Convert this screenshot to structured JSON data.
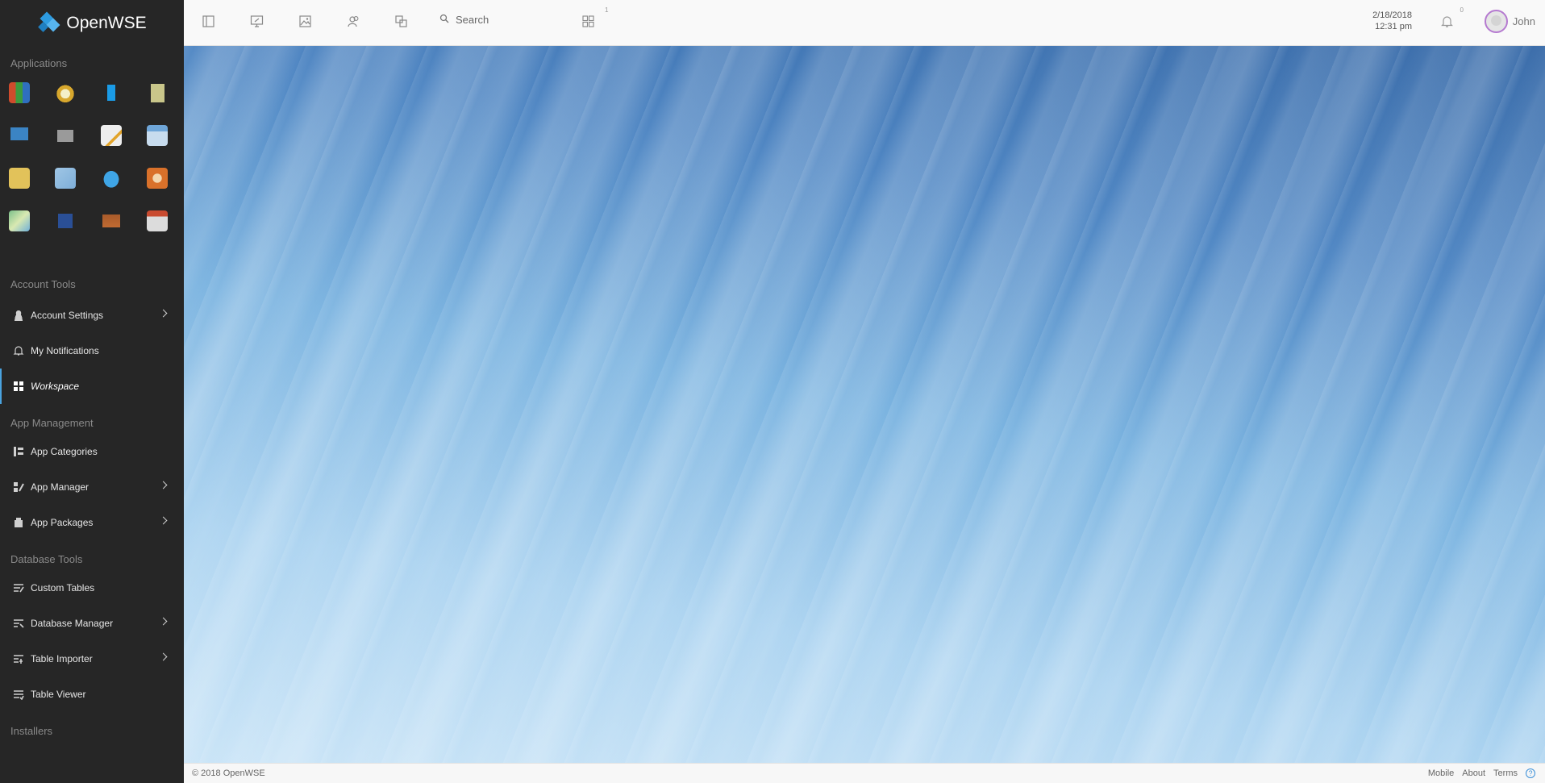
{
  "brand": {
    "title": "OpenWSE",
    "accent": "#2d9be0"
  },
  "sidebar": {
    "applications_title": "Applications",
    "apps": [
      {
        "icon": "tiles-icon"
      },
      {
        "icon": "alarm-clock-icon"
      },
      {
        "icon": "bookmark-icon"
      },
      {
        "icon": "notebook-icon"
      },
      {
        "icon": "chat-icon"
      },
      {
        "icon": "drive-icon"
      },
      {
        "icon": "editor-icon"
      },
      {
        "icon": "calendar-icon"
      },
      {
        "icon": "sticky-note-icon"
      },
      {
        "icon": "map-icon"
      },
      {
        "icon": "twitter-icon"
      },
      {
        "icon": "radio-icon"
      },
      {
        "icon": "world-map-icon"
      },
      {
        "icon": "3d-box-icon"
      },
      {
        "icon": "wallet-icon"
      },
      {
        "icon": "planner-icon"
      }
    ],
    "account_tools_title": "Account Tools",
    "account_settings": "Account Settings",
    "my_notifications": "My Notifications",
    "workspace": "Workspace",
    "app_management_title": "App Management",
    "app_categories": "App Categories",
    "app_manager": "App Manager",
    "app_packages": "App Packages",
    "database_tools_title": "Database Tools",
    "custom_tables": "Custom Tables",
    "database_manager": "Database Manager",
    "table_importer": "Table Importer",
    "table_viewer": "Table Viewer",
    "installers_title": "Installers"
  },
  "topbar": {
    "search_label": "Search",
    "workspaces_count": "1",
    "date": "2/18/2018",
    "time": "12:31 pm",
    "notifications_count": "0",
    "user_name": "John"
  },
  "footer": {
    "copyright": "© 2018 OpenWSE",
    "mobile": "Mobile",
    "about": "About",
    "terms": "Terms",
    "help": "?"
  }
}
